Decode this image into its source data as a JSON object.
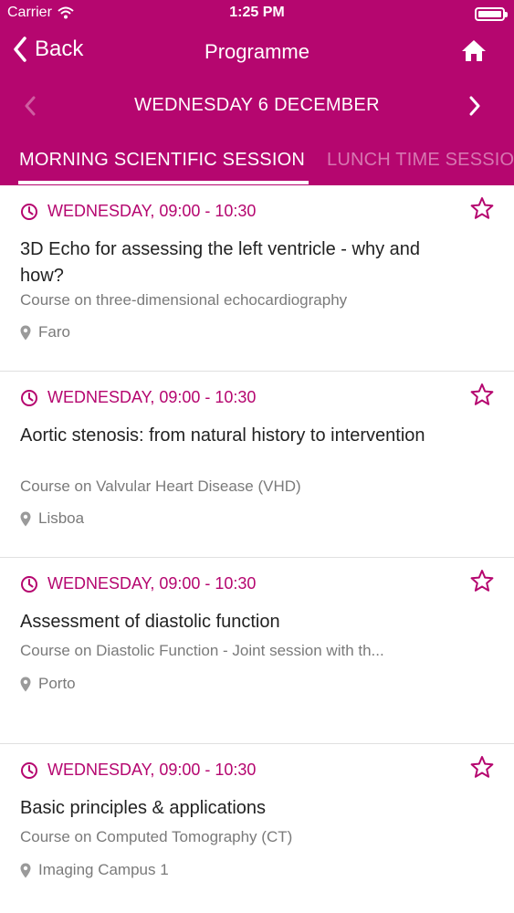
{
  "status_bar": {
    "carrier": "Carrier",
    "time": "1:25 PM"
  },
  "nav": {
    "back_label": "Back",
    "title": "Programme"
  },
  "date_nav": {
    "label": "WEDNESDAY 6 DECEMBER"
  },
  "tabs": [
    {
      "label": "MORNING SCIENTIFIC SESSION",
      "active": true
    },
    {
      "label": "LUNCH TIME SESSIONS",
      "active": false
    }
  ],
  "sessions": [
    {
      "time": "WEDNESDAY, 09:00 - 10:30",
      "title": "3D Echo for assessing the left ventricle - why and how?",
      "subtitle": "Course on three-dimensional echocardiography",
      "location": "Faro"
    },
    {
      "time": "WEDNESDAY, 09:00 - 10:30",
      "title": "Aortic stenosis: from natural history to intervention",
      "subtitle": "Course on Valvular Heart Disease (VHD)",
      "location": "Lisboa"
    },
    {
      "time": "WEDNESDAY, 09:00 - 10:30",
      "title": "Assessment of diastolic function",
      "subtitle": "Course on Diastolic Function - Joint session with th...",
      "location": "Porto"
    },
    {
      "time": "WEDNESDAY, 09:00 - 10:30",
      "title": "Basic principles & applications",
      "subtitle": "Course on Computed Tomography (CT)",
      "location": "Imaging Campus 1"
    }
  ],
  "icons": {
    "back": "chevron-left-icon",
    "home": "home-icon",
    "prev": "chevron-left-icon",
    "next": "chevron-right-icon",
    "clock": "clock-icon",
    "star": "star-outline-icon",
    "location": "location-pin-icon"
  },
  "colors": {
    "accent": "#b5066f",
    "text": "#222222",
    "muted": "#7a7a7a",
    "divider": "#e0e0e0"
  }
}
